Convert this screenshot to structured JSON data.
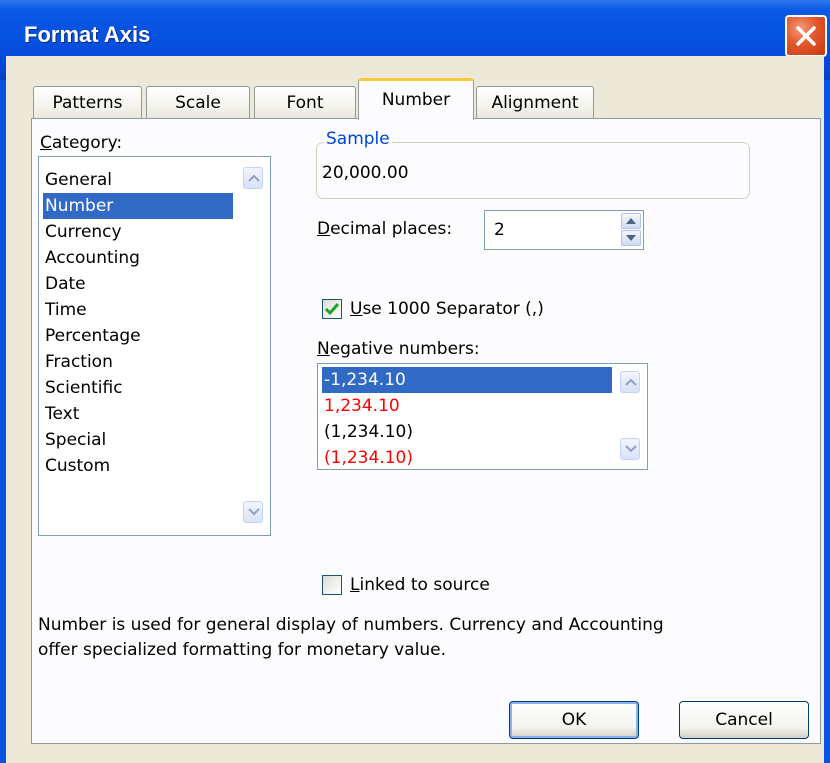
{
  "window": {
    "title": "Format Axis"
  },
  "tabs": [
    {
      "label": "Patterns"
    },
    {
      "label": "Scale"
    },
    {
      "label": "Font"
    },
    {
      "label": "Number",
      "active": true
    },
    {
      "label": "Alignment"
    }
  ],
  "category": {
    "label_underlined": "C",
    "label_rest": "ategory:",
    "items": [
      "General",
      "Number",
      "Currency",
      "Accounting",
      "Date",
      "Time",
      "Percentage",
      "Fraction",
      "Scientific",
      "Text",
      "Special",
      "Custom"
    ],
    "selected": "Number"
  },
  "sample": {
    "label": "Sample",
    "value": "20,000.00"
  },
  "decimal_places": {
    "label_underlined": "D",
    "label_rest": "ecimal places:",
    "value": "2"
  },
  "separator": {
    "label_underlined": "U",
    "label_rest": "se 1000 Separator (,)",
    "checked": true
  },
  "negative_numbers": {
    "label_underlined": "N",
    "label_rest": "egative numbers:",
    "items": [
      {
        "text": "-1,234.10",
        "color": "#ffffff",
        "selected": true
      },
      {
        "text": "1,234.10",
        "color": "#ff0000"
      },
      {
        "text": "(1,234.10)",
        "color": "#000000"
      },
      {
        "text": "(1,234.10)",
        "color": "#ff0000"
      }
    ]
  },
  "linked_to_source": {
    "label_underlined": "L",
    "label_rest": "inked to source",
    "checked": false
  },
  "description": {
    "line1": "Number is used for general display of numbers.  Currency and Accounting",
    "line2": "offer specialized formatting for monetary value."
  },
  "buttons": {
    "ok": "OK",
    "cancel": "Cancel"
  },
  "colors": {
    "titlebar": "#0651e0",
    "selection": "#316ac5",
    "dialog_bg": "#ece9d8",
    "active_tab_accent": "#ffc83c",
    "checkmark": "#21a121"
  }
}
